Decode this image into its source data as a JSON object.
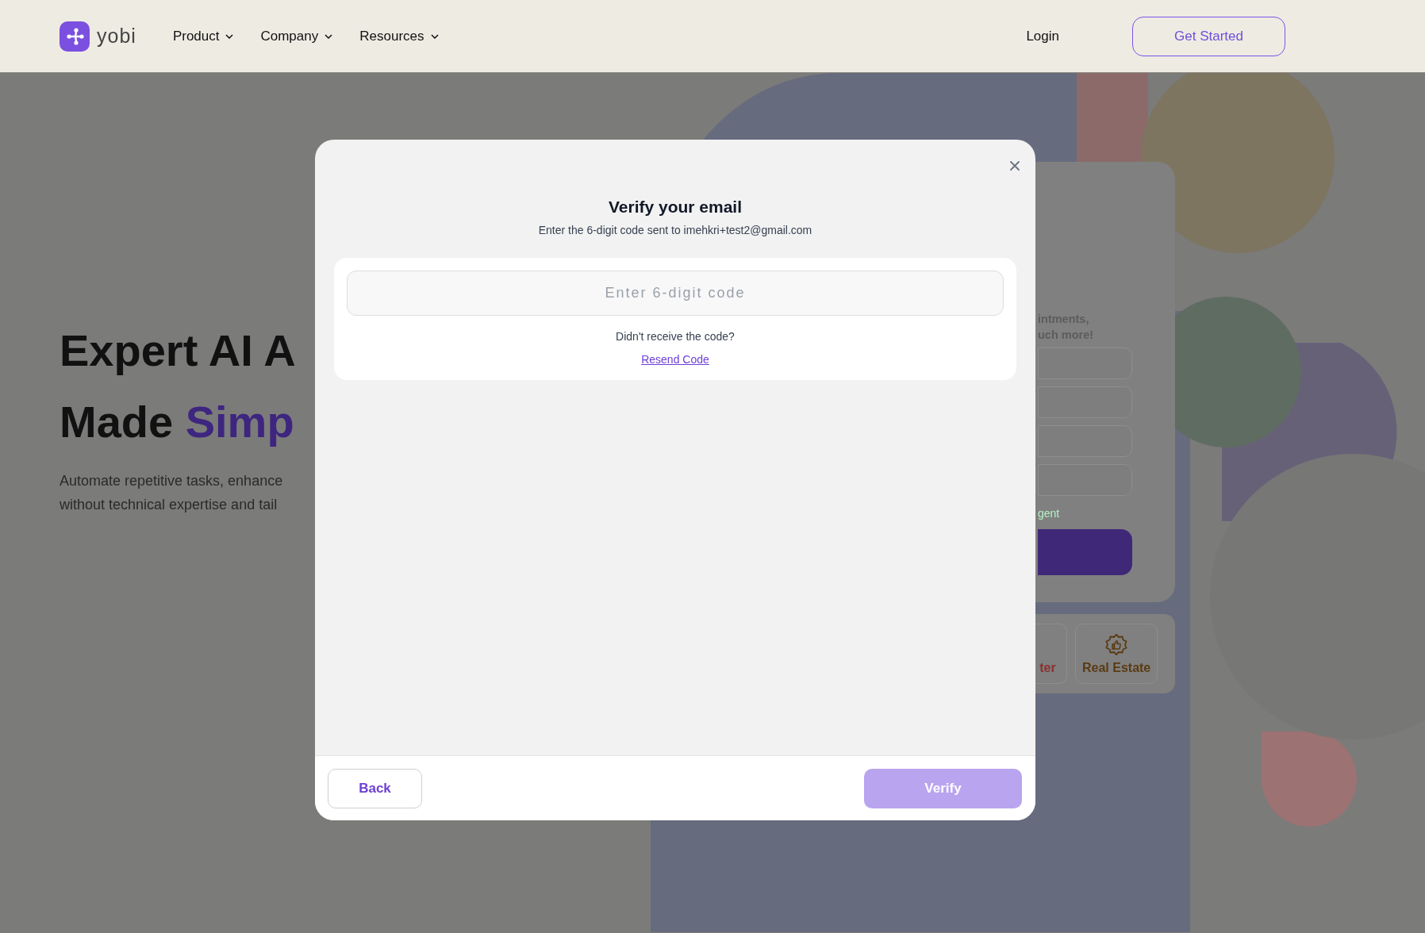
{
  "header": {
    "logo_text": "yobi",
    "nav": [
      {
        "label": "Product"
      },
      {
        "label": "Company"
      },
      {
        "label": "Resources"
      }
    ],
    "login": "Login",
    "cta": "Get Started"
  },
  "hero": {
    "title_line_1": "Expert AI A",
    "title_line_2_start": "Made",
    "title_line_2_accent": "Simp",
    "description_lines": [
      "Automate repetitive tasks, enhance",
      "without technical expertise and tail"
    ]
  },
  "signup_card": {
    "text_lines": [
      "intments,",
      "uch more!"
    ],
    "link_text": "gent"
  },
  "industries": [
    {
      "label": "ter",
      "color": "#8a2f2f"
    },
    {
      "label": "Real Estate",
      "color": "#5a3a12"
    }
  ],
  "modal": {
    "title": "Verify your email",
    "subtitle": "Enter the 6-digit code sent to imehkri+test2@gmail.com",
    "code_field": {
      "placeholder": "Enter 6-digit code"
    },
    "resend_prompt": "Didn't receive the code?",
    "resend_link": "Resend Code",
    "back_button": "Back",
    "verify_button": {
      "label": "Verify",
      "disabled": true
    }
  }
}
